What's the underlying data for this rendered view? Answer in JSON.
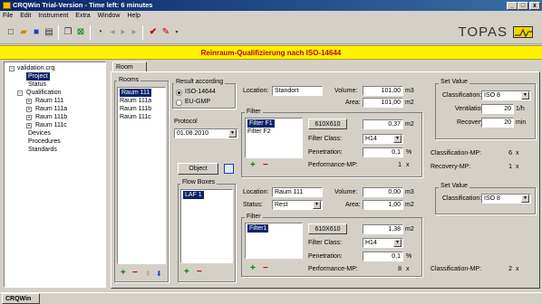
{
  "window": {
    "title": "CRQWin Trial-Version - Time left: 6 minutes",
    "controls": [
      "_",
      "□",
      "x"
    ]
  },
  "menu": [
    "File",
    "Edit",
    "Instrument",
    "Extra",
    "Window",
    "Help"
  ],
  "toolbar": {
    "logo": "TOPAS"
  },
  "banner": "Reinraum-Qualifizierung nach ISO-14644",
  "tree": {
    "root": "validation.crq",
    "items": [
      "Project",
      "Status",
      "Qualification",
      "Raum 111",
      "Raum 111a",
      "Raum 111b",
      "Raum 111c",
      "Devices",
      "Procedures",
      "Standards"
    ]
  },
  "tab": "Room",
  "rooms": {
    "label": "Rooms",
    "items": [
      "Raum 111",
      "Raum 111a",
      "Raum 111b",
      "Raum 111c"
    ]
  },
  "result": {
    "label": "Result according",
    "opt1": "ISO-14644",
    "opt2": "EU-GMP"
  },
  "protocol": {
    "label": "Protocol",
    "value": "01.08.2010"
  },
  "object_button": "Object",
  "room_info": {
    "location_label": "Location:",
    "location": "Standort",
    "volume_label": "Volume:",
    "volume": "101,00",
    "volume_unit": "m3",
    "area_label": "Area:",
    "area": "101,00",
    "area_unit": "m2"
  },
  "filter1": {
    "label": "Filter",
    "items": [
      "Filter F1",
      "Filter F2"
    ],
    "size_button": "610X610",
    "area": "0,37",
    "area_unit": "m2",
    "class_label": "Filter Class:",
    "class": "H14",
    "pen_label": "Penetration:",
    "pen": "0,1",
    "pen_unit": "%",
    "perf_label": "Performance-MP:",
    "perf": "1",
    "perf_unit": "x"
  },
  "setvalue1": {
    "label": "Set Value",
    "class_label": "Classification:",
    "class": "ISO 8",
    "vent_label": "Ventilation:",
    "vent": "20",
    "vent_unit": "1/h",
    "rec_label": "Recovery:",
    "rec": "20",
    "rec_unit": "min"
  },
  "mp1": {
    "class_label": "Classification-MP:",
    "class": "6",
    "class_unit": "x",
    "rec_label": "Recovery-MP:",
    "rec": "1",
    "rec_unit": "x"
  },
  "flow": {
    "label": "Flow Boxes",
    "items": [
      "LAF 1"
    ],
    "location_label": "Location:",
    "location": "Raum 111",
    "volume_label": "Volume:",
    "volume": "0,00",
    "volume_unit": "m3",
    "status_label": "Status:",
    "status": "Rest",
    "area_label": "Area:",
    "area": "1,00",
    "area_unit": "m2"
  },
  "filter2": {
    "label": "Filter",
    "items": [
      "Filter1"
    ],
    "size_button": "610X610",
    "area": "1,38",
    "area_unit": "m2",
    "class_label": "Filter Class:",
    "class": "H14",
    "pen_label": "Penetration:",
    "pen": "0,1",
    "pen_unit": "%",
    "perf_label": "Performance-MP:",
    "perf": "8",
    "perf_unit": "x"
  },
  "setvalue2": {
    "label": "Set Value",
    "class_label": "Classification:",
    "class": "ISO 8"
  },
  "mp2": {
    "class_label": "Classification-MP:",
    "class": "2",
    "class_unit": "x"
  },
  "statusbar": "CRQWin"
}
